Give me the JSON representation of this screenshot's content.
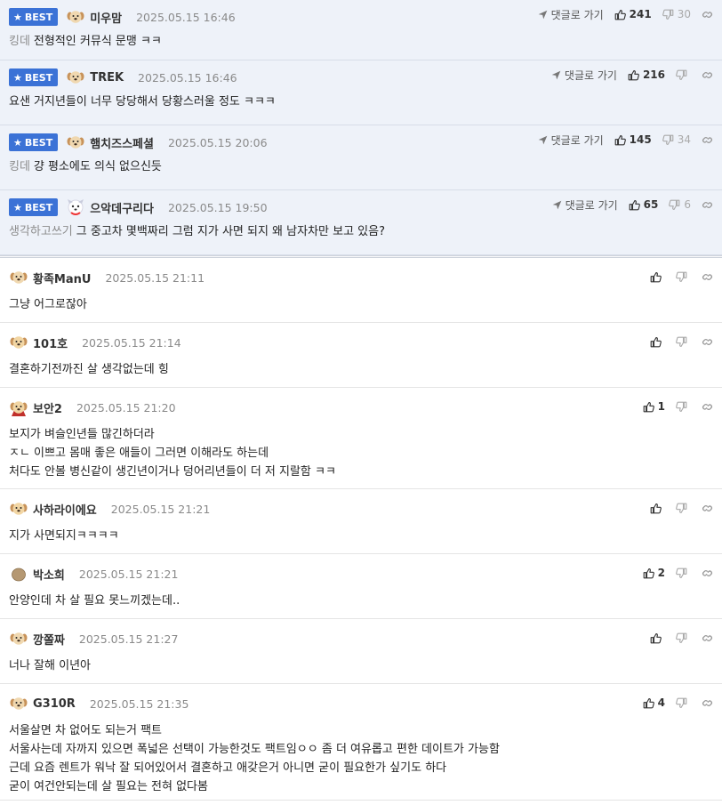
{
  "labels": {
    "best": "BEST",
    "reply": "댓글로 가기"
  },
  "best_comments": [
    {
      "nickname": "미우맘",
      "date": "2025.05.15 16:46",
      "prefix": "킹데",
      "text": "전형적인 커뮤식 문맹 ㅋㅋ",
      "likes": "241",
      "dislikes": "30",
      "avatar": "puppy-icon"
    },
    {
      "nickname": "TREK",
      "date": "2025.05.15 16:46",
      "prefix": "",
      "text": "요샌 거지년들이 너무 당당해서 당황스러울 정도 ㅋㅋㅋ",
      "likes": "216",
      "dislikes": "",
      "avatar": "puppy-icon"
    },
    {
      "nickname": "햄치즈스페셜",
      "date": "2025.05.15 20:06",
      "prefix": "킹데",
      "text": "걍 평소에도 의식 없으신듯",
      "likes": "145",
      "dislikes": "34",
      "avatar": "puppy-icon"
    },
    {
      "nickname": "으악데구리다",
      "date": "2025.05.15 19:50",
      "prefix": "생각하고쓰기",
      "text": "그 중고차 몇백짜리 그럼 지가 사면 되지 왜 남자차만 보고 있음?",
      "likes": "65",
      "dislikes": "6",
      "avatar": "dog-icon"
    }
  ],
  "comments": [
    {
      "nickname": "황족ManU",
      "date": "2025.05.15 21:11",
      "likes": "",
      "avatar": "puppy-icon",
      "lines": [
        "그냥 어그로잖아"
      ]
    },
    {
      "nickname": "101호",
      "date": "2025.05.15 21:14",
      "likes": "",
      "avatar": "labrador-icon",
      "lines": [
        "결혼하기전까진 살 생각없는데 힝"
      ]
    },
    {
      "nickname": "보안2",
      "date": "2025.05.15 21:20",
      "likes": "1",
      "avatar": "caped-dog-icon",
      "lines": [
        "보지가 벼슬인년들 많긴하더라",
        "ㅈㄴ 이쁘고 몸매 좋은 애들이 그러면 이해라도 하는데",
        "처다도 안볼 병신같이 생긴년이거나 덩어리년들이 더 저 지랄함 ㅋㅋ"
      ]
    },
    {
      "nickname": "사하라이에요",
      "date": "2025.05.15 21:21",
      "likes": "",
      "avatar": "labrador-icon",
      "lines": [
        "지가 사면되지ㅋㅋㅋㅋ"
      ]
    },
    {
      "nickname": "박소희",
      "date": "2025.05.15 21:21",
      "likes": "2",
      "avatar": "potato-icon",
      "lines": [
        "안양인데 차 살 필요 못느끼겠는데.."
      ]
    },
    {
      "nickname": "깡쫄짜",
      "date": "2025.05.15 21:27",
      "likes": "",
      "avatar": "puppy-icon",
      "lines": [
        "너나 잘해 이년아"
      ]
    },
    {
      "nickname": "G310R",
      "date": "2025.05.15 21:35",
      "likes": "4",
      "avatar": "puppy-icon",
      "lines": [
        "서울살면 차 없어도 되는거 팩트",
        "서울사는데 자까지 있으면 폭넓은 선택이 가능한것도 팩트임ㅇㅇ 좀 더 여유롭고 편한 데이트가 가능함",
        "근데 요즘 렌트가 워낙 잘 되어있어서 결혼하고 애갖은거 아니면 굳이 필요한가 싶기도 하다",
        "굳이 여건안되는데 살 필요는 전혀 없다봄"
      ]
    }
  ]
}
